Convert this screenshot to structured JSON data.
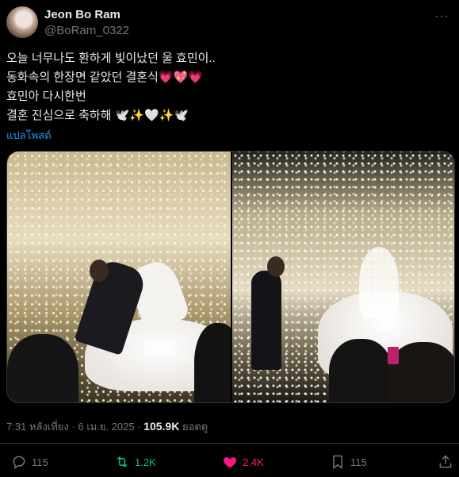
{
  "author": {
    "name": "Jeon Bo Ram",
    "handle": "@BoRam_0322"
  },
  "more_icon": "more-horizontal-icon",
  "tweet_lines": [
    "오늘 너무나도  환하게 빛이났던 울 효민이..",
    "동화속의 한장면 같았던 결혼식💗💖💗",
    "효민아 다시한번",
    "결혼 진심으로 축하해 🕊️✨🤍✨🕊️"
  ],
  "translate_label": "แปลโพสต์",
  "meta": {
    "time": "7:31 หลังเที่ยง",
    "date": "6 เม.ย. 2025",
    "views": "105.9K",
    "views_label": "ยอดดู"
  },
  "actions": {
    "replies": "115",
    "retweets": "1.2K",
    "likes": "2.4K",
    "bookmarks": "115"
  },
  "colors": {
    "background": "#000000",
    "text": "#e7e9ea",
    "muted": "#71767b",
    "link": "#1d9bf0",
    "retweet": "#00ba7c",
    "like": "#f91880"
  }
}
